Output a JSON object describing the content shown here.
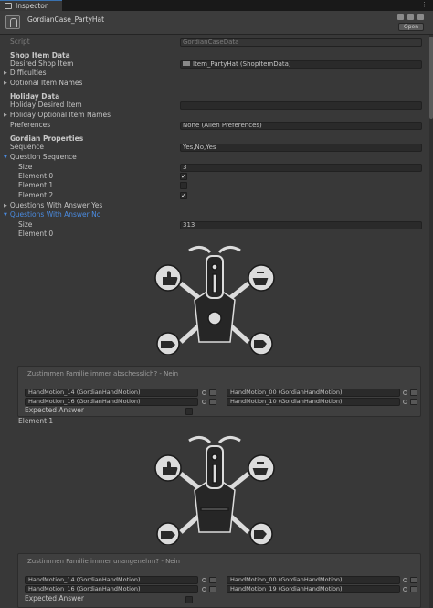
{
  "tab": {
    "label": "Inspector"
  },
  "header": {
    "title": "GordianCase_PartyHat",
    "open_label": "Open"
  },
  "fields": {
    "script_label": "Script",
    "script_value": "GordianCaseData",
    "shop_item_data": "Shop Item Data",
    "desired_shop_item_label": "Desired Shop Item",
    "desired_shop_item_value": "Item_PartyHat (ShopItemData)",
    "difficulties": "Difficulties",
    "optional_item_names": "Optional Item Names",
    "holiday_data": "Holiday Data",
    "holiday_desired_item": "Holiday Desired Item",
    "holiday_optional_item_names": "Holiday Optional Item Names",
    "preferences_label": "Preferences",
    "preferences_value": "None (Alien Preferences)",
    "gordian_properties": "Gordian Properties",
    "sequence_label": "Sequence",
    "sequence_value": "Yes,No,Yes",
    "question_sequence": "Question Sequence",
    "size_label": "Size",
    "size_value": "3",
    "element0": "Element 0",
    "element1": "Element 1",
    "element2": "Element 2",
    "questions_yes": "Questions With Answer Yes",
    "questions_no": "Questions With Answer No",
    "size2_label": "Size",
    "size2_value": "313",
    "no_element0": "Element 0",
    "no_element1": "Element 1"
  },
  "checks": {
    "element0": true,
    "element1": false,
    "element2": true
  },
  "panel1": {
    "title": "Zustimmen Familie immer abschesslich? - Nein",
    "left_top": "HandMotion_14 (GordianHandMotion)",
    "left_bottom": "HandMotion_16 (GordianHandMotion)",
    "right_top": "HandMotion_00 (GordianHandMotion)",
    "right_bottom": "HandMotion_10 (GordianHandMotion)",
    "expected_answer": "Expected Answer"
  },
  "panel2": {
    "title": "Zustimmen Familie immer unangenehm? - Nein",
    "left_top": "HandMotion_14 (GordianHandMotion)",
    "left_bottom": "HandMotion_16 (GordianHandMotion)",
    "right_top": "HandMotion_00 (GordianHandMotion)",
    "right_bottom": "HandMotion_19 (GordianHandMotion)",
    "expected_answer": "Expected Answer"
  },
  "icons": [
    "thumbs-up-icon",
    "open-hand-icon",
    "rock-hand-icon",
    "scissors-hand-icon"
  ]
}
